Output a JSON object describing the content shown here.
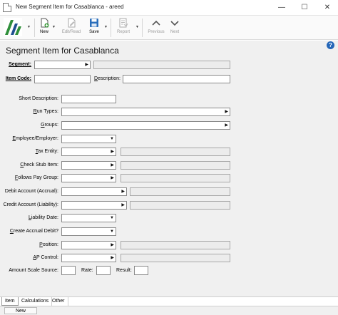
{
  "window": {
    "title": "New Segment Item for Casablanca - areed",
    "minimize_glyph": "—",
    "maximize_glyph": "☐",
    "close_glyph": "✕"
  },
  "toolbar": {
    "new_label": "New",
    "edit_read_label": "Edit/Read",
    "save_label": "Save",
    "report_label": "Report",
    "previous_label": "Previous",
    "next_label": "Next"
  },
  "page": {
    "heading": "Segment Item for Casablanca",
    "help_glyph": "?"
  },
  "form": {
    "segment_label": "Segment:",
    "item_code_label": "Item Code:",
    "description_label": "Description:",
    "short_description_label": "Short Description:",
    "run_types_label": "Run Types:",
    "groups_label": "Groups:",
    "employee_employer_label": "Employee/Employer:",
    "tax_entity_label": "Tax Entity:",
    "check_stub_item_label": "Check Stub Item:",
    "follows_pay_group_label": "Follows Pay Group:",
    "debit_account_label": "Debit Account (Accrual):",
    "credit_account_label": "Credit Account (Liability):",
    "liability_date_label": "Liability Date:",
    "create_accrual_debit_label": "Create Accrual Debit?",
    "position_label": "Position:",
    "ap_control_label": "AP Control:",
    "amount_scale_source_label": "Amount Scale Source:",
    "rate_label": "Rate:",
    "result_label": "Result:"
  },
  "tabs": {
    "item": "Item",
    "calculations": "Calculations",
    "other": "Other"
  },
  "status": {
    "mode": "New"
  },
  "colors": {
    "logo_green": "#2f8f3a",
    "logo_blue": "#1f4f8f",
    "help_blue": "#2466b8"
  }
}
